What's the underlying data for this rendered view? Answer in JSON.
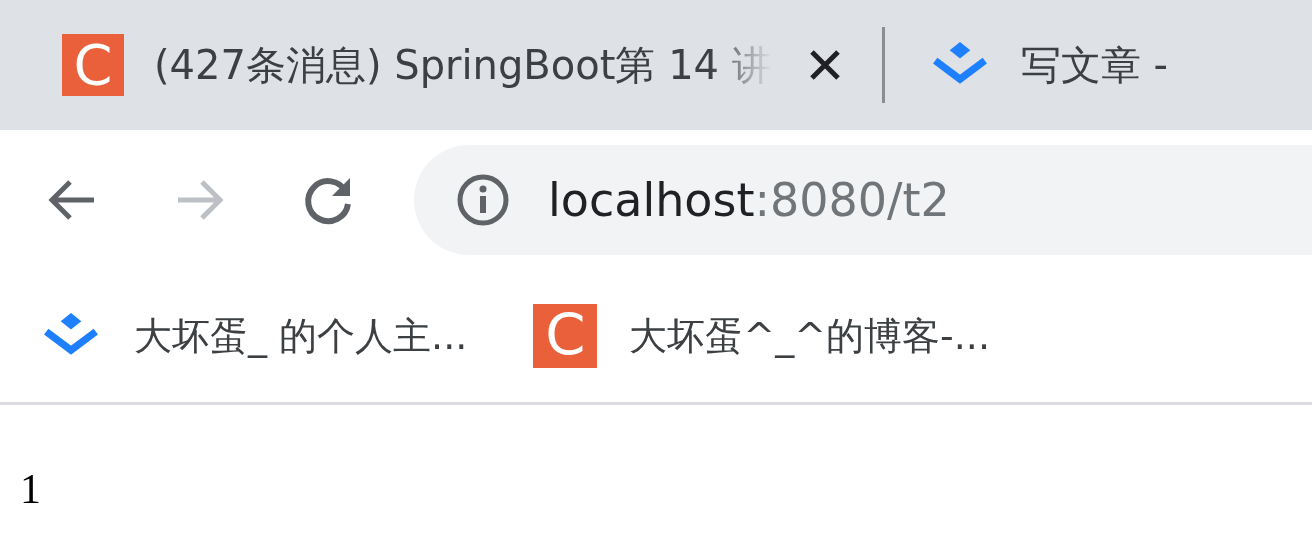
{
  "tabs": [
    {
      "kind": "csdn",
      "logo": "C",
      "title": "(427条消息) SpringBoot第 14 讲",
      "closable": true
    },
    {
      "kind": "juejin",
      "title": "写文章 - ",
      "closable": false
    }
  ],
  "toolbar": {
    "back_disabled": false,
    "forward_disabled": true,
    "url_host": "localhost",
    "url_rest": ":8080/t2"
  },
  "bookmarks": [
    {
      "kind": "juejin",
      "title": "大坏蛋_ 的个人主..."
    },
    {
      "kind": "csdn",
      "logo": "C",
      "title": "大坏蛋^_^的博客-..."
    }
  ],
  "page": {
    "text": "1"
  }
}
